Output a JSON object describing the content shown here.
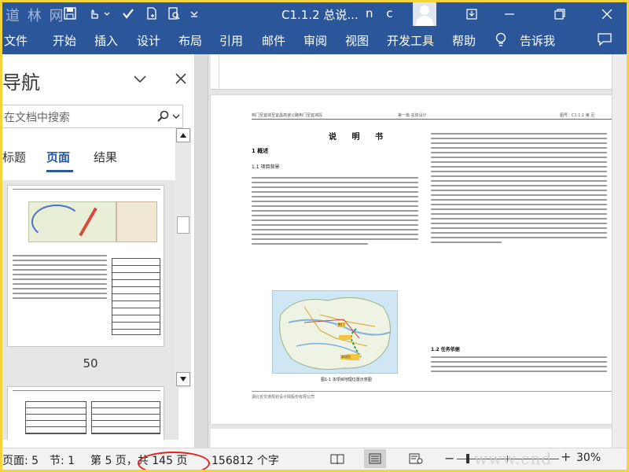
{
  "watermark_top": "道 林 网",
  "watermark_bottom": "www.cnd  eam.com",
  "title_bar": {
    "doc_title": "C1.1.2 总说...",
    "user_initials": "n c"
  },
  "ribbon": {
    "tabs": [
      "文件",
      "开始",
      "插入",
      "设计",
      "布局",
      "引用",
      "邮件",
      "审阅",
      "视图",
      "开发工具",
      "帮助",
      "告诉我"
    ]
  },
  "navigation": {
    "title": "导航",
    "search_placeholder": "在文档中搜索",
    "tabs": [
      "标题",
      "页面",
      "结果"
    ],
    "active_tab": "页面",
    "page_thumb_label": "50"
  },
  "document": {
    "header_left": "荆门至宜城至宜昌高速公路荆门至宜城段",
    "header_mid": "第一篇 总体设计",
    "header_right": "图号：C1.1.1 第 页",
    "title": "说 明 书",
    "section1": "1 概述",
    "section1_1": "1.1 项目背景",
    "section1_2": "1.2 任务依据",
    "figure_caption": "图1-1 本项目地理位置示意图",
    "footer": "湖北省交通规划设计院股份有限公司",
    "map_label": "本项目"
  },
  "status_bar": {
    "page": "页面: 5",
    "section": "节: 1",
    "page_of": "第 5 页，共 145 页",
    "word_count": "156812 个字",
    "zoom": "30%"
  }
}
